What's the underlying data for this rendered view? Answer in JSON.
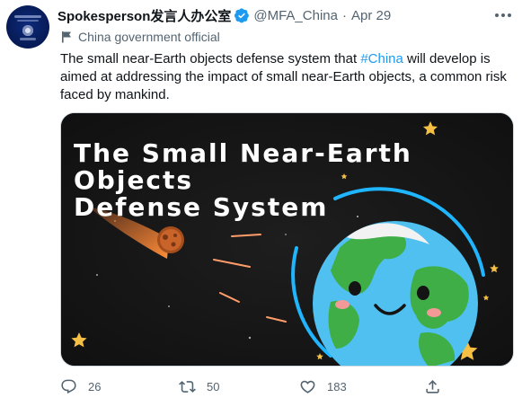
{
  "tweet": {
    "author_name": "Spokesperson发言人办公室",
    "handle": "@MFA_China",
    "separator": "·",
    "date": "Apr 29",
    "label": "China government official",
    "text_before": "The small near-Earth objects defense system that ",
    "hashtag": "#China",
    "text_after": " will develop is aimed at addressing the impact of small near-Earth objects, a common risk faced by mankind."
  },
  "media": {
    "title_line1": "The Small Near-Earth Objects",
    "title_line2": "Defense System"
  },
  "actions": {
    "replies": "26",
    "retweets": "50",
    "likes": "183"
  },
  "colors": {
    "link": "#1d9bf0",
    "verified": "#1d9bf0",
    "secondary_text": "#536471",
    "ring": "#1fb6ff"
  },
  "icons": {
    "verified": "verified-badge-icon",
    "label": "flag-icon",
    "more": "more-dots-icon",
    "reply": "reply-icon",
    "retweet": "retweet-icon",
    "like": "heart-icon",
    "share": "share-icon"
  }
}
